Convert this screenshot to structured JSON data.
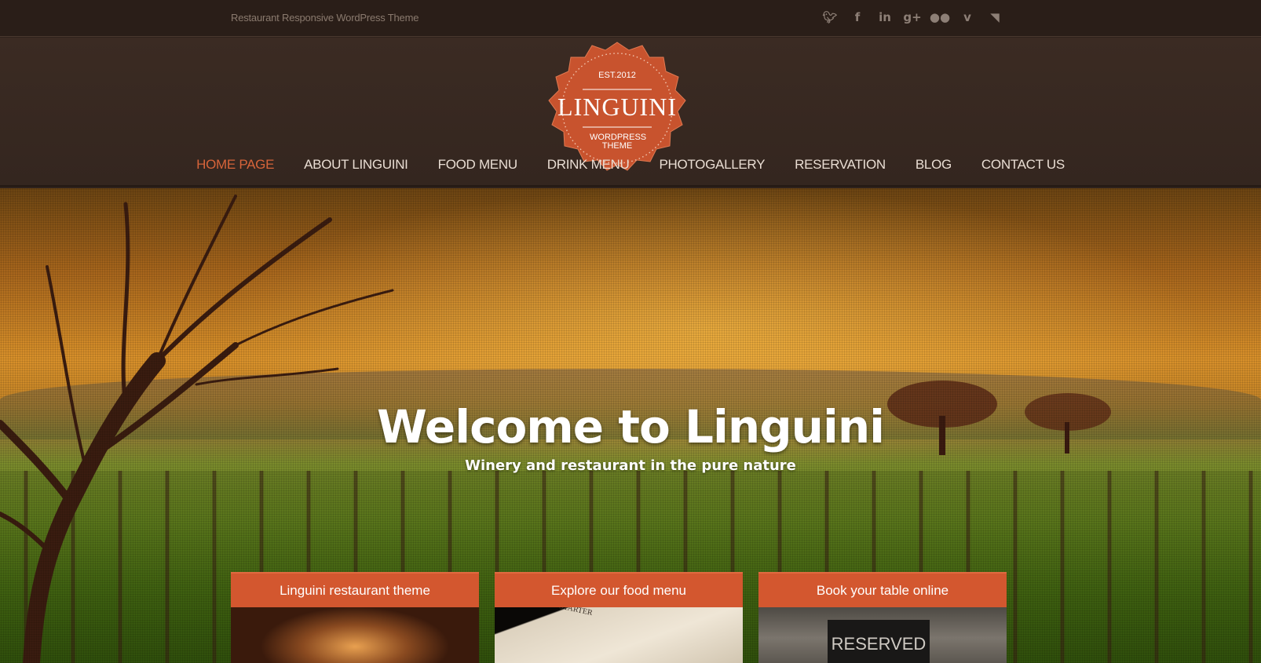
{
  "topbar": {
    "tagline": "Restaurant Responsive WordPress Theme",
    "social_icons": [
      "twitter-icon",
      "facebook-icon",
      "linkedin-icon",
      "google-plus-icon",
      "flickr-icon",
      "vimeo-icon",
      "rss-icon"
    ]
  },
  "logo": {
    "established": "EST.2012",
    "name": "LINGUINI",
    "sub_line1": "WORDPRESS",
    "sub_line2": "THEME"
  },
  "nav": {
    "items": [
      {
        "label": "HOME PAGE",
        "active": true
      },
      {
        "label": "ABOUT LINGUINI"
      },
      {
        "label": "FOOD MENU"
      },
      {
        "label": "DRINK MENU"
      },
      {
        "label": "PHOTOGALLERY"
      },
      {
        "label": "RESERVATION"
      },
      {
        "label": "BLOG"
      },
      {
        "label": "CONTACT US"
      }
    ]
  },
  "hero": {
    "title": "Welcome to Linguini",
    "subtitle": "Winery and restaurant in the pure nature"
  },
  "boxes": [
    {
      "title": "Linguini restaurant theme"
    },
    {
      "title": "Explore our food menu",
      "image_text": "STARTER"
    },
    {
      "title": "Book your table online",
      "image_text": "RESERVED"
    }
  ],
  "colors": {
    "accent": "#d3572f",
    "nav_active": "#d7643a",
    "header_bg": "#34261f"
  }
}
